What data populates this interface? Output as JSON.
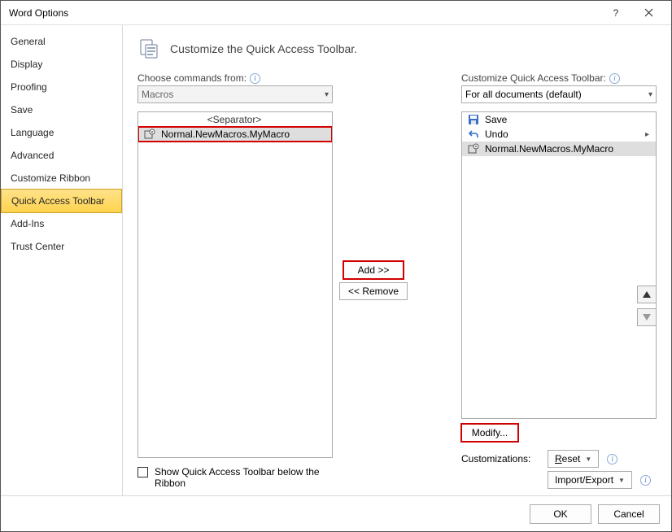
{
  "window": {
    "title": "Word Options"
  },
  "sidebar": {
    "items": [
      {
        "label": "General"
      },
      {
        "label": "Display"
      },
      {
        "label": "Proofing"
      },
      {
        "label": "Save"
      },
      {
        "label": "Language"
      },
      {
        "label": "Advanced"
      },
      {
        "label": "Customize Ribbon"
      },
      {
        "label": "Quick Access Toolbar",
        "selected": true
      },
      {
        "label": "Add-Ins"
      },
      {
        "label": "Trust Center"
      }
    ]
  },
  "main": {
    "heading": "Customize the Quick Access Toolbar.",
    "left": {
      "label": "Choose commands from:",
      "combo_value": "Macros",
      "list": {
        "separator": "<Separator>",
        "items": [
          {
            "label": "Normal.NewMacros.MyMacro",
            "icon": "macro-icon",
            "selected": true,
            "highlight": true
          }
        ]
      }
    },
    "mid": {
      "add": "Add >>",
      "remove": "<< Remove"
    },
    "right": {
      "label": "Customize Quick Access Toolbar:",
      "combo_value": "For all documents (default)",
      "list": {
        "items": [
          {
            "label": "Save",
            "icon": "save-icon"
          },
          {
            "label": "Undo",
            "icon": "undo-icon",
            "submenu": true
          },
          {
            "label": "Normal.NewMacros.MyMacro",
            "icon": "macro-icon",
            "selected": true
          }
        ]
      },
      "modify": "Modify...",
      "customizations_label": "Customizations:",
      "reset": "Reset",
      "import_export": "Import/Export"
    },
    "checkbox": {
      "label": "Show Quick Access Toolbar below the Ribbon"
    }
  },
  "footer": {
    "ok": "OK",
    "cancel": "Cancel"
  }
}
